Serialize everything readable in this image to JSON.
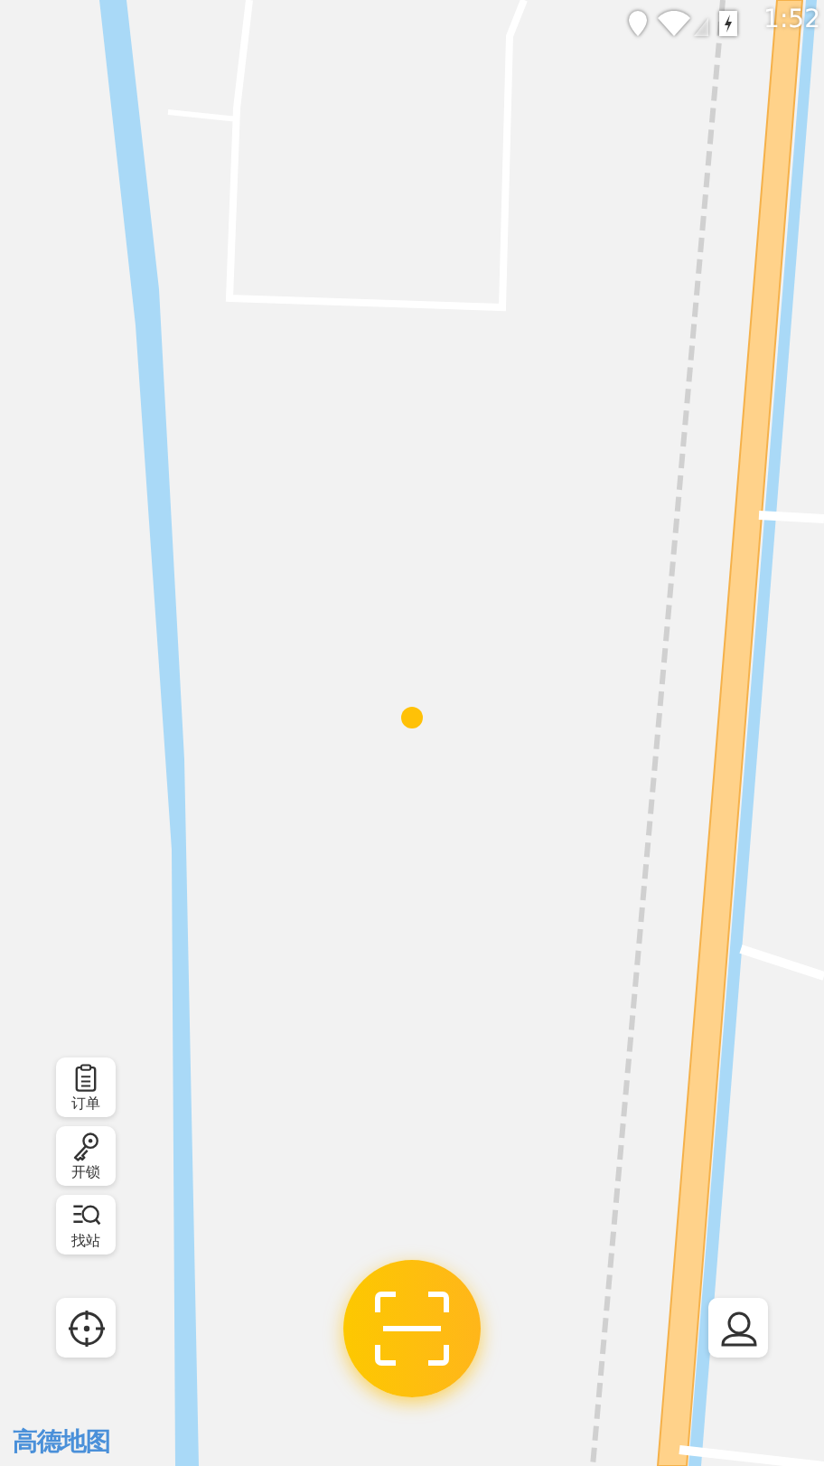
{
  "status_bar": {
    "time": "1:52"
  },
  "map": {
    "kind": "picture",
    "attribution": "高德地图"
  },
  "side_buttons": [
    {
      "kind": "clipboard",
      "label": "订单"
    },
    {
      "kind": "key",
      "label": "开锁"
    },
    {
      "kind": "search-list",
      "label": "找站"
    }
  ]
}
